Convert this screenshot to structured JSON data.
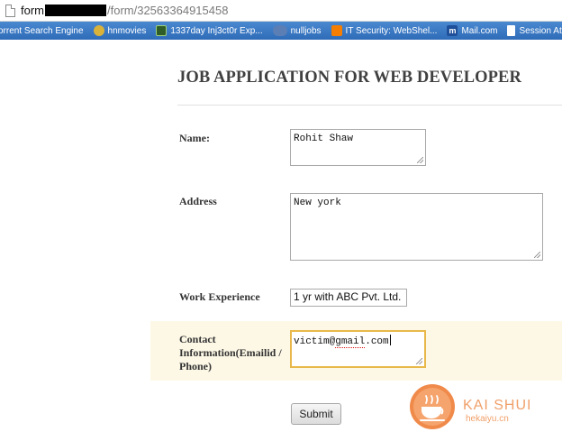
{
  "browser": {
    "url_prefix": "form",
    "url_suffix": "/form/32563364915458",
    "bookmarks": [
      {
        "label": "orrent Search Engine",
        "icon": "globe-icon",
        "color": "#3e7bc8"
      },
      {
        "label": "hnmovies",
        "icon": "hn-badge-icon",
        "color": "#d9b23a"
      },
      {
        "label": "1337day Inj3ct0r Exp...",
        "icon": "exploit-icon",
        "color": "#4a8a3a"
      },
      {
        "label": "nulljobs",
        "icon": "nulljobs-icon",
        "color": "#5577aa"
      },
      {
        "label": "IT Security: WebShel...",
        "icon": "blogger-icon",
        "color": "#f57d00"
      },
      {
        "label": "Mail.com",
        "icon": "mail-icon",
        "color": "#1f4f99"
      },
      {
        "label": "Session Attacks",
        "icon": "document-icon",
        "color": "#ffffff"
      }
    ]
  },
  "form": {
    "title": "JOB APPLICATION FOR WEB DEVELOPER",
    "fields": {
      "name": {
        "label": "Name:",
        "value": "Rohit Shaw"
      },
      "address": {
        "label": "Address",
        "value": "New york"
      },
      "work_experience": {
        "label": "Work Experience",
        "value": "1 yr with ABC Pvt. Ltd."
      },
      "contact": {
        "label_line1": "Contact",
        "label_line2": "Information(Emailid /",
        "label_line3": "Phone)",
        "value_user": "victim@",
        "value_domain": "gmail",
        "value_tld": ".com"
      }
    },
    "submit_label": "Submit"
  },
  "watermark": {
    "brand": "KAI SHUI",
    "domain": "hekaiyu.cn"
  },
  "colors": {
    "bookmark_bar": "#3b78c2",
    "highlight_row": "#fdf8e6",
    "focus_border": "#e8b84a",
    "watermark": "#f0a06a"
  }
}
